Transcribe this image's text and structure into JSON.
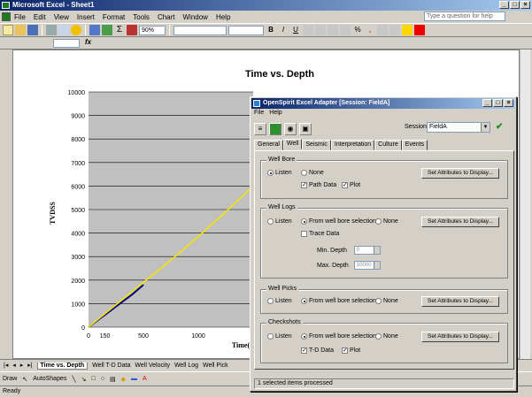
{
  "window": {
    "title": "Microsoft Excel - Sheet1"
  },
  "menu": [
    "File",
    "Edit",
    "View",
    "Insert",
    "Format",
    "Tools",
    "Chart",
    "Window",
    "Help"
  ],
  "help_placeholder": "Type a question for help",
  "toolbar": {
    "zoom": "90%"
  },
  "formula": {
    "fx": "fx"
  },
  "chart_data": {
    "type": "line",
    "title": "Time vs. Depth",
    "ylabel": "TVDSS",
    "xlabel": "Time(",
    "x_ticks": [
      "0",
      "500",
      "1000",
      "150"
    ],
    "y_ticks": [
      "0",
      "1000",
      "2000",
      "3000",
      "4000",
      "5000",
      "6000",
      "7000",
      "8000",
      "9000",
      "10000"
    ],
    "xlim": [
      0,
      1500
    ],
    "ylim": [
      0,
      10000
    ],
    "series": [
      {
        "color": "#000080",
        "x": [
          0,
          100,
          200,
          300,
          400,
          500
        ],
        "y": [
          0,
          350,
          700,
          1050,
          1400,
          1800
        ]
      },
      {
        "color": "#f5e400",
        "x": [
          0,
          250,
          500,
          750,
          1000,
          1250,
          1500
        ],
        "y": [
          0,
          950,
          1900,
          2850,
          3850,
          4900,
          6000
        ]
      }
    ]
  },
  "sheet_tabs": {
    "active": "Time vs. Depth",
    "others": [
      "Well T-D Data",
      "Well Velocity",
      "Well Log",
      "Well Pick"
    ]
  },
  "drawbar": {
    "draw": "Draw",
    "autoshapes": "AutoShapes"
  },
  "status": "Ready",
  "dialog": {
    "title": "OpenSpirit Excel Adapter [Session: FieldA]",
    "menu": [
      "File",
      "Help"
    ],
    "session_label": "Session",
    "session_value": "FieldA",
    "tabs": [
      "General",
      "Well",
      "Seismic",
      "Interpretation",
      "Culture",
      "Events"
    ],
    "selected_tab": "Well",
    "groups": {
      "well_bore": {
        "title": "Well Bore",
        "listen": "Listen",
        "none": "None",
        "path_data": "Path Data",
        "plot": "Plot",
        "button": "Set Attributes to Display..."
      },
      "well_logs": {
        "title": "Well Logs",
        "listen": "Listen",
        "from_sel": "From well bore selection",
        "none": "None",
        "trace_data": "Trace Data",
        "min_depth": "Min. Depth",
        "min_value": "0",
        "max_depth": "Max. Depth",
        "max_value": "10000",
        "button": "Set Attributes to Display..."
      },
      "well_picks": {
        "title": "Well Picks",
        "listen": "Listen",
        "from_sel": "From well bore selection",
        "none": "None",
        "button": "Set Attributes to Display..."
      },
      "checkshots": {
        "title": "Checkshots",
        "listen": "Listen",
        "from_sel": "From well bore selection",
        "none": "None",
        "td_data": "T-D Data",
        "plot": "Plot",
        "button": "Set Attributes to Display..."
      }
    },
    "status": "1 selected items processed"
  }
}
